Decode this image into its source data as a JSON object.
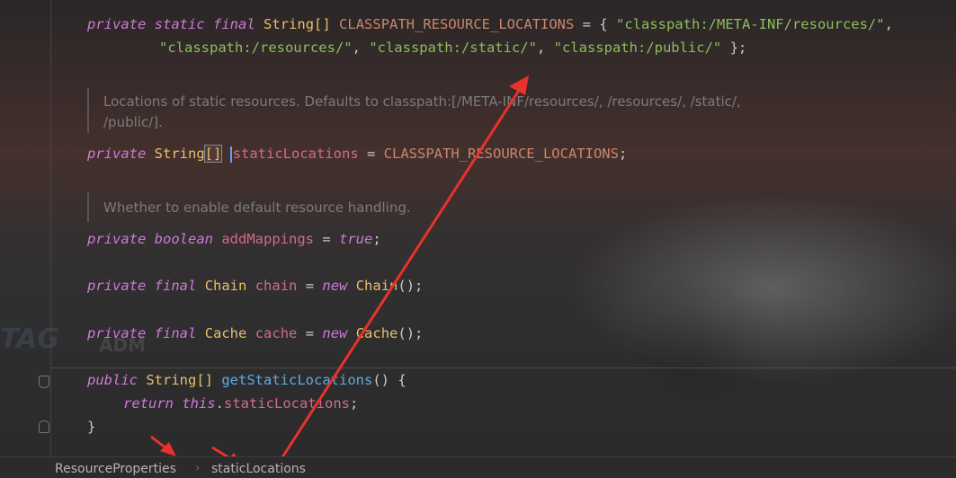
{
  "background": {
    "logo_text": "TAG",
    "logo_sub": "ADM"
  },
  "code": {
    "line1": {
      "private": "private",
      "static": "static",
      "final": "final",
      "type": "String[]",
      "name": "CLASSPATH_RESOURCE_LOCATIONS",
      "eq": " = { ",
      "s1": "\"classpath:/META-INF/resources/\"",
      "comma": ","
    },
    "line2": {
      "s2": "\"classpath:/resources/\"",
      "c1": ", ",
      "s3": "\"classpath:/static/\"",
      "c2": ", ",
      "s4": "\"classpath:/public/\"",
      "end": " };"
    },
    "doc1_line1": "Locations of static resources. Defaults to classpath:[/META-INF/resources/, /resources/, /static/,",
    "doc1_line2": "/public/].",
    "line3": {
      "private": "private",
      "type": "String",
      "brackets": "[]",
      "name": "staticLocations",
      "eq": " = ",
      "value": "CLASSPATH_RESOURCE_LOCATIONS",
      "end": ";"
    },
    "doc2": "Whether to enable default resource handling.",
    "line4": {
      "private": "private",
      "type": "boolean",
      "name": "addMappings",
      "eq": " = ",
      "value": "true",
      "end": ";"
    },
    "line5": {
      "private": "private",
      "final": "final",
      "type": "Chain",
      "name": "chain",
      "eq": " = ",
      "new": "new",
      "ctor": "Chain",
      "end": "();"
    },
    "line6": {
      "private": "private",
      "final": "final",
      "type": "Cache",
      "name": "cache",
      "eq": " = ",
      "new": "new",
      "ctor": "Cache",
      "end": "();"
    },
    "line7": {
      "public": "public",
      "type": "String[]",
      "method": "getStaticLocations",
      "end": "() {"
    },
    "line8": {
      "return": "return",
      "this": "this",
      "dot": ".",
      "name": "staticLocations",
      "end": ";"
    },
    "line9": {
      "brace": "}"
    }
  },
  "breadcrumb": {
    "items": [
      "ResourceProperties",
      "staticLocations"
    ],
    "separator": "›"
  },
  "colors": {
    "arrow": "#e8322b",
    "keyword": "#cc7ad6",
    "string": "#8bbf5a"
  }
}
